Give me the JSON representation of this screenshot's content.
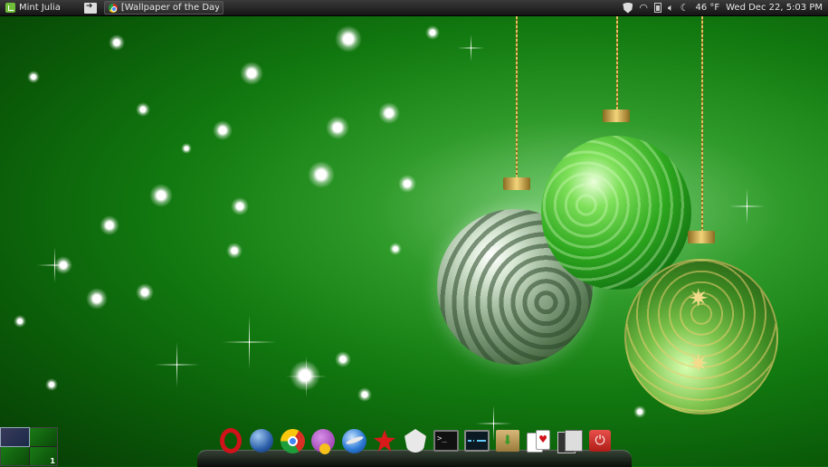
{
  "panel": {
    "menu_label": "Mint Julia",
    "task_title": "[Wallpaper of the Day ...",
    "weather": "46 °F",
    "datetime": "Wed Dec 22,  5:03 PM",
    "tray_icons": [
      "shield-icon",
      "wifi-icon",
      "battery-icon",
      "volume-icon",
      "weather-moon-icon"
    ]
  },
  "workspaces": {
    "active_index": 0,
    "count": 4,
    "current_number": "1"
  },
  "dock": {
    "apps": [
      "opera",
      "web-browser-globe",
      "google-chrome",
      "pidgin",
      "google-earth",
      "pokerstars",
      "gimp",
      "terminal",
      "system-monitor",
      "package-manager",
      "card-game",
      "file-manager",
      "power"
    ]
  },
  "colors": {
    "wallpaper_green": "#127a10",
    "panel_bg": "#1e1e1e"
  }
}
